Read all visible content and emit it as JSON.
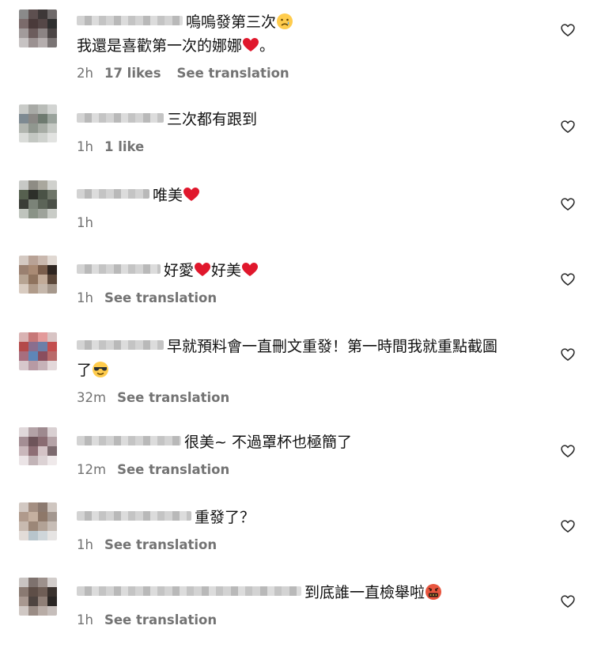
{
  "comments": [
    {
      "line1": "嗚嗚發第三次",
      "line2a": "我還是喜歡第一次的娜娜",
      "line2b": "。",
      "time": "2h",
      "likes": "17 likes",
      "see_translation": "See translation",
      "emoji1": "crying-face",
      "emoji2": "red-heart"
    },
    {
      "text": "三次都有跟到",
      "time": "1h",
      "likes": "1 like"
    },
    {
      "text": "唯美",
      "time": "1h",
      "emoji": "red-heart"
    },
    {
      "text_a": "好愛",
      "text_b": "好美",
      "time": "1h",
      "see_translation": "See translation",
      "emoji": "red-heart"
    },
    {
      "line1": "早就預料會一直刪文重發！第一時間我就重點截圖",
      "line2": "了",
      "time": "32m",
      "see_translation": "See translation",
      "emoji": "smiling-face-with-sunglasses"
    },
    {
      "text": "很美~ 不過罩杯也極簡了",
      "time": "12m",
      "see_translation": "See translation"
    },
    {
      "text": "重發了？",
      "time": "1h",
      "see_translation": "See translation"
    },
    {
      "text": "到底誰一直檢舉啦",
      "time": "1h",
      "see_translation": "See translation",
      "emoji": "face-with-symbols-on-mouth"
    }
  ],
  "colors": {
    "meta_text": "#737373",
    "body_text": "#111111",
    "heart_emoji": "#e0172c",
    "like_icon_stroke": "#262626"
  }
}
